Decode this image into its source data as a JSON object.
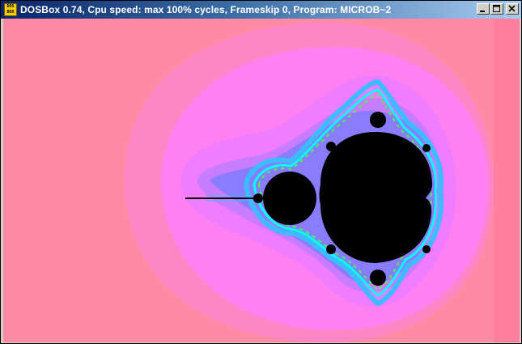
{
  "window": {
    "title": "DOSBox 0.74, Cpu speed: max 100% cycles, Frameskip  0, Program: MICROB~2",
    "icon_label": "DOS BOX",
    "buttons": [
      "minimize",
      "maximize",
      "close"
    ]
  },
  "content": {
    "subject": "Mandelbrot set fractal",
    "colors": {
      "outer": "#ff8aa6",
      "band1": "#ff86c6",
      "band2": "#ff80f0",
      "band3": "#f07cff",
      "band4": "#c87cff",
      "band5": "#8a7cff",
      "set": "#000000",
      "fringe_blue": "#3cbcff",
      "fringe_cyan": "#00ffff",
      "fringe_green": "#40ff40"
    }
  }
}
